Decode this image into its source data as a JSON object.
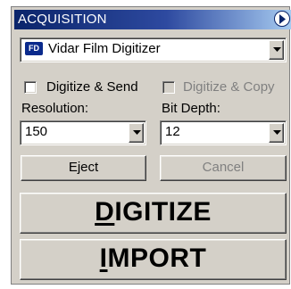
{
  "panel": {
    "title": "ACQUISITION"
  },
  "device": {
    "badge": "FD",
    "selected": "Vidar Film Digitizer"
  },
  "options": {
    "digitize_send": {
      "label": "Digitize & Send",
      "checked": false,
      "enabled": true
    },
    "digitize_copy": {
      "label": "Digitize & Copy",
      "checked": false,
      "enabled": false
    }
  },
  "resolution": {
    "label": "Resolution:",
    "value": "150"
  },
  "bit_depth": {
    "label": "Bit Depth:",
    "value": "12"
  },
  "buttons": {
    "eject": "Eject",
    "cancel": "Cancel",
    "digitize_mnemonic": "D",
    "digitize_rest": "IGITIZE",
    "import_mnemonic": "I",
    "import_rest": "MPORT"
  },
  "icons": {
    "collapse": "collapse-arrow-icon",
    "dropdown": "chevron-down-icon",
    "device": "fd-device-icon"
  }
}
